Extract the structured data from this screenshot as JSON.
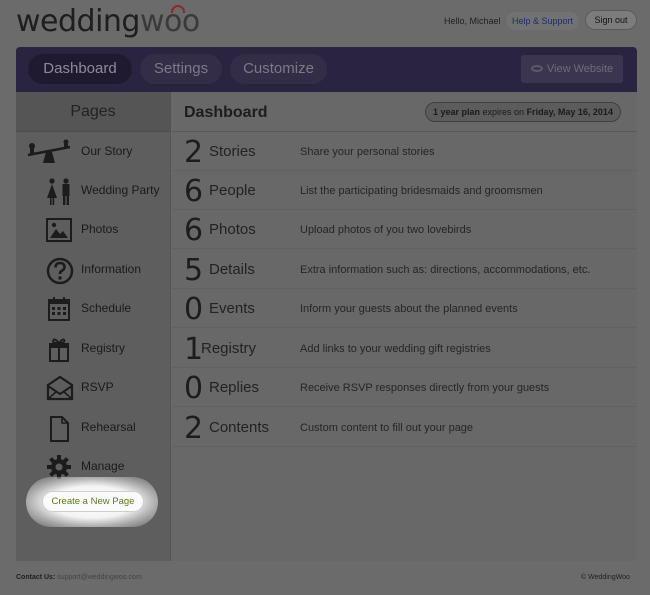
{
  "header": {
    "logo_part1": "wedding",
    "logo_part2": "woo",
    "greeting": "Hello, Michael",
    "help_label": "Help & Support",
    "signout_label": "Sign out"
  },
  "nav": {
    "tabs": [
      {
        "label": "Dashboard",
        "active": true
      },
      {
        "label": "Settings",
        "active": false
      },
      {
        "label": "Customize",
        "active": false
      }
    ],
    "view_website_label": "View Website"
  },
  "sidebar": {
    "title": "Pages",
    "items": [
      {
        "label": "Our Story",
        "icon": "seesaw-icon"
      },
      {
        "label": "Wedding Party",
        "icon": "couple-icon"
      },
      {
        "label": "Photos",
        "icon": "photo-icon"
      },
      {
        "label": "Information",
        "icon": "question-icon"
      },
      {
        "label": "Schedule",
        "icon": "calendar-icon"
      },
      {
        "label": "Registry",
        "icon": "gift-icon"
      },
      {
        "label": "RSVP",
        "icon": "envelope-icon"
      },
      {
        "label": "Rehearsal",
        "icon": "document-icon"
      },
      {
        "label": "Manage",
        "icon": "gear-icon"
      }
    ],
    "create_button_label": "Create a New Page"
  },
  "dashboard": {
    "title": "Dashboard",
    "plan_prefix": "1 year plan",
    "plan_middle": " expires on ",
    "plan_date": "Friday, May 16, 2014",
    "rows": [
      {
        "count": "2",
        "word": "Stories",
        "desc": "Share your personal stories"
      },
      {
        "count": "6",
        "word": "People",
        "desc": "List the participating bridesmaids and groomsmen"
      },
      {
        "count": "6",
        "word": "Photos",
        "desc": "Upload photos of you two lovebirds"
      },
      {
        "count": "5",
        "word": "Details",
        "desc": "Extra information such as: directions, accommodations, etc."
      },
      {
        "count": "0",
        "word": "Events",
        "desc": "Inform your guests about the planned events"
      },
      {
        "count": "1",
        "word": "Registry",
        "desc": "Add links to your wedding gift registries"
      },
      {
        "count": "0",
        "word": "Replies",
        "desc": "Receive RSVP responses directly from your guests"
      },
      {
        "count": "2",
        "word": "Contents",
        "desc": "Custom content to fill out your page"
      }
    ]
  },
  "footer": {
    "contact_label": "Contact Us:",
    "contact_email": "support@weddingwoo.com",
    "copyright": "© WeddingWoo"
  }
}
